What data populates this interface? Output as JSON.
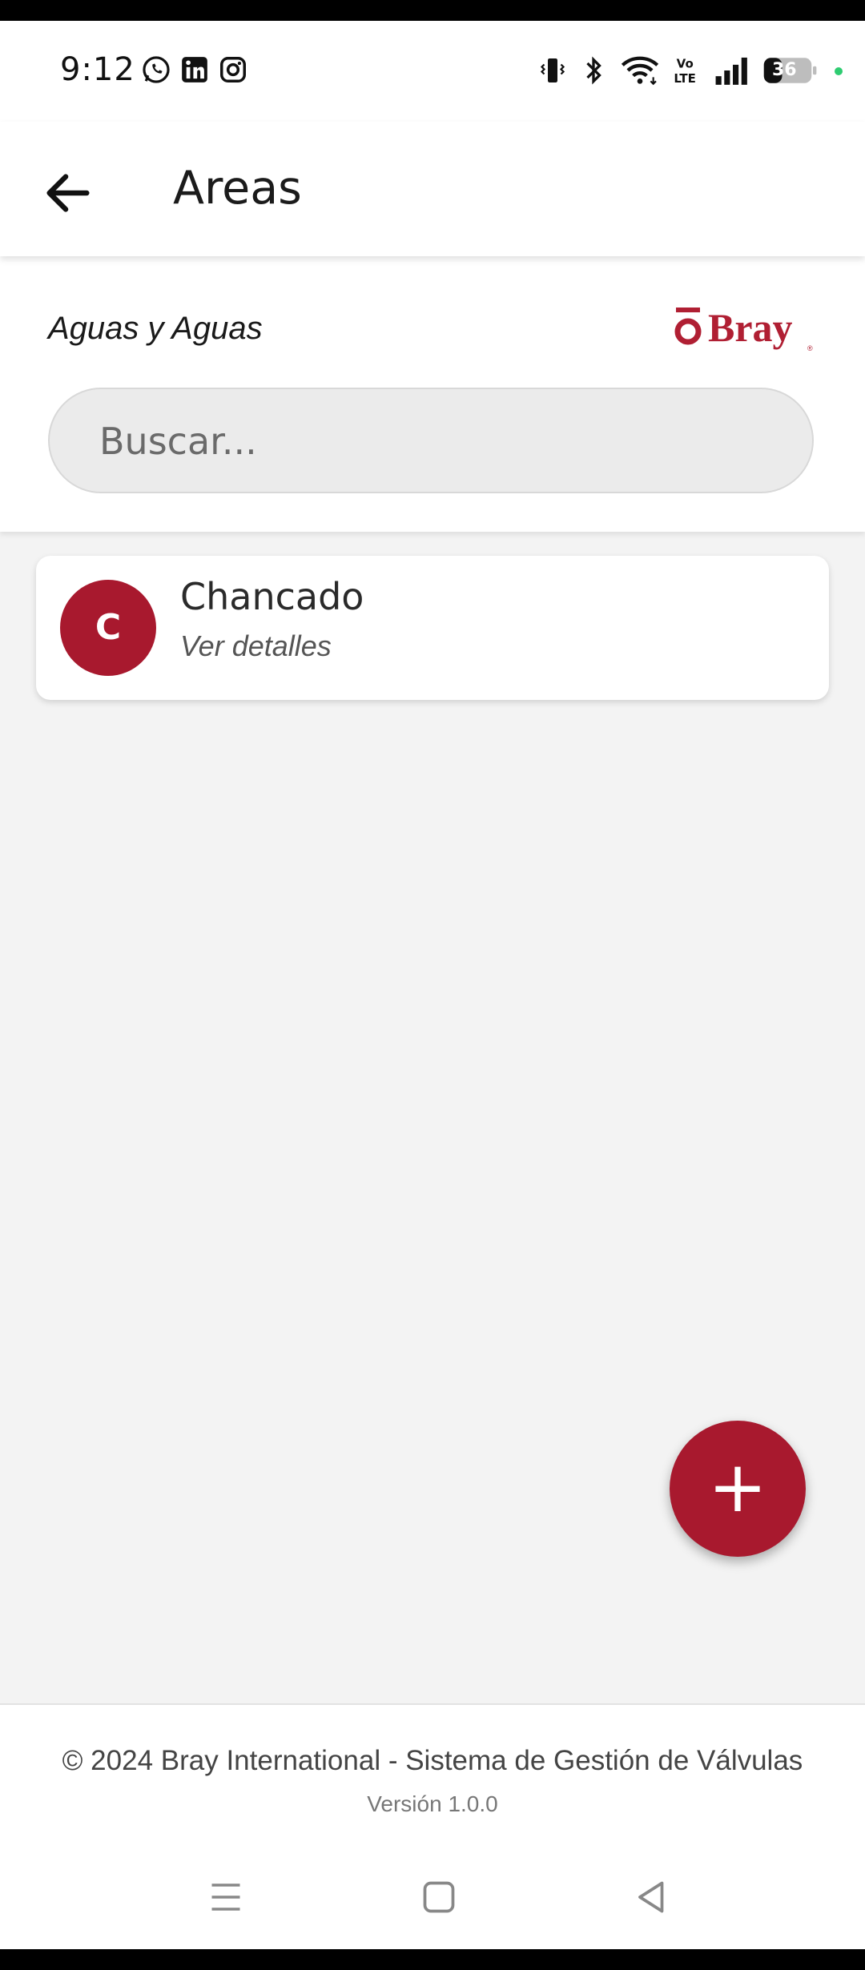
{
  "status_bar": {
    "time": "9:12",
    "notification_icons": [
      "whatsapp-icon",
      "linkedin-icon",
      "instagram-icon"
    ],
    "system_icons": [
      "vibrate-icon",
      "bluetooth-icon",
      "wifi-icon",
      "volte-icon",
      "signal-icon",
      "battery-icon"
    ],
    "battery_level": "36"
  },
  "app_bar": {
    "title": "Areas",
    "back_icon": "arrow-left-icon"
  },
  "header": {
    "company_name": "Aguas y Aguas",
    "logo_text": "Bray",
    "search_placeholder": "Buscar...",
    "search_value": ""
  },
  "areas": [
    {
      "initial": "C",
      "name": "Chancado",
      "action": "Ver detalles"
    }
  ],
  "fab": {
    "label": "+",
    "icon": "plus-icon"
  },
  "footer": {
    "copyright": "© 2024 Bray International - Sistema de Gestión de Válvulas",
    "version": "Versión 1.0.0"
  },
  "colors": {
    "accent": "#a8192e",
    "background": "#f3f3f3",
    "surface": "#ffffff"
  }
}
